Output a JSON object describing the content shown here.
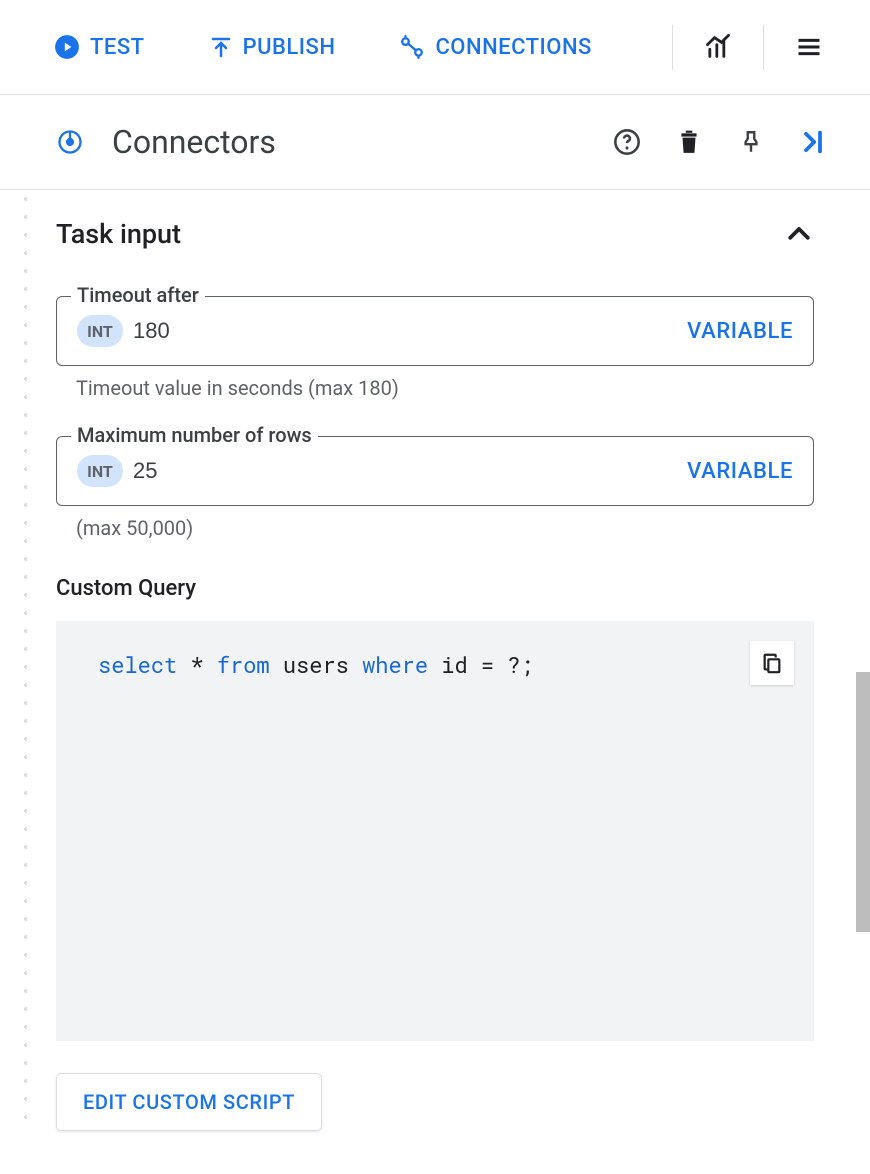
{
  "toolbar": {
    "test_label": "TEST",
    "publish_label": "PUBLISH",
    "connections_label": "CONNECTIONS"
  },
  "section": {
    "title": "Connectors"
  },
  "task_input": {
    "header": "Task input",
    "timeout": {
      "label": "Timeout after",
      "chip": "INT",
      "value": "180",
      "variable_label": "VARIABLE",
      "help": "Timeout value in seconds (max 180)"
    },
    "max_rows": {
      "label": "Maximum number of rows",
      "chip": "INT",
      "value": "25",
      "variable_label": "VARIABLE",
      "help": "(max 50,000)"
    },
    "custom_query_label": "Custom Query",
    "custom_query_tokens": {
      "t1": "select",
      "t2": " * ",
      "t3": "from",
      "t4": " users ",
      "t5": "where",
      "t6": " id = ?;"
    },
    "edit_button": "EDIT CUSTOM SCRIPT"
  }
}
